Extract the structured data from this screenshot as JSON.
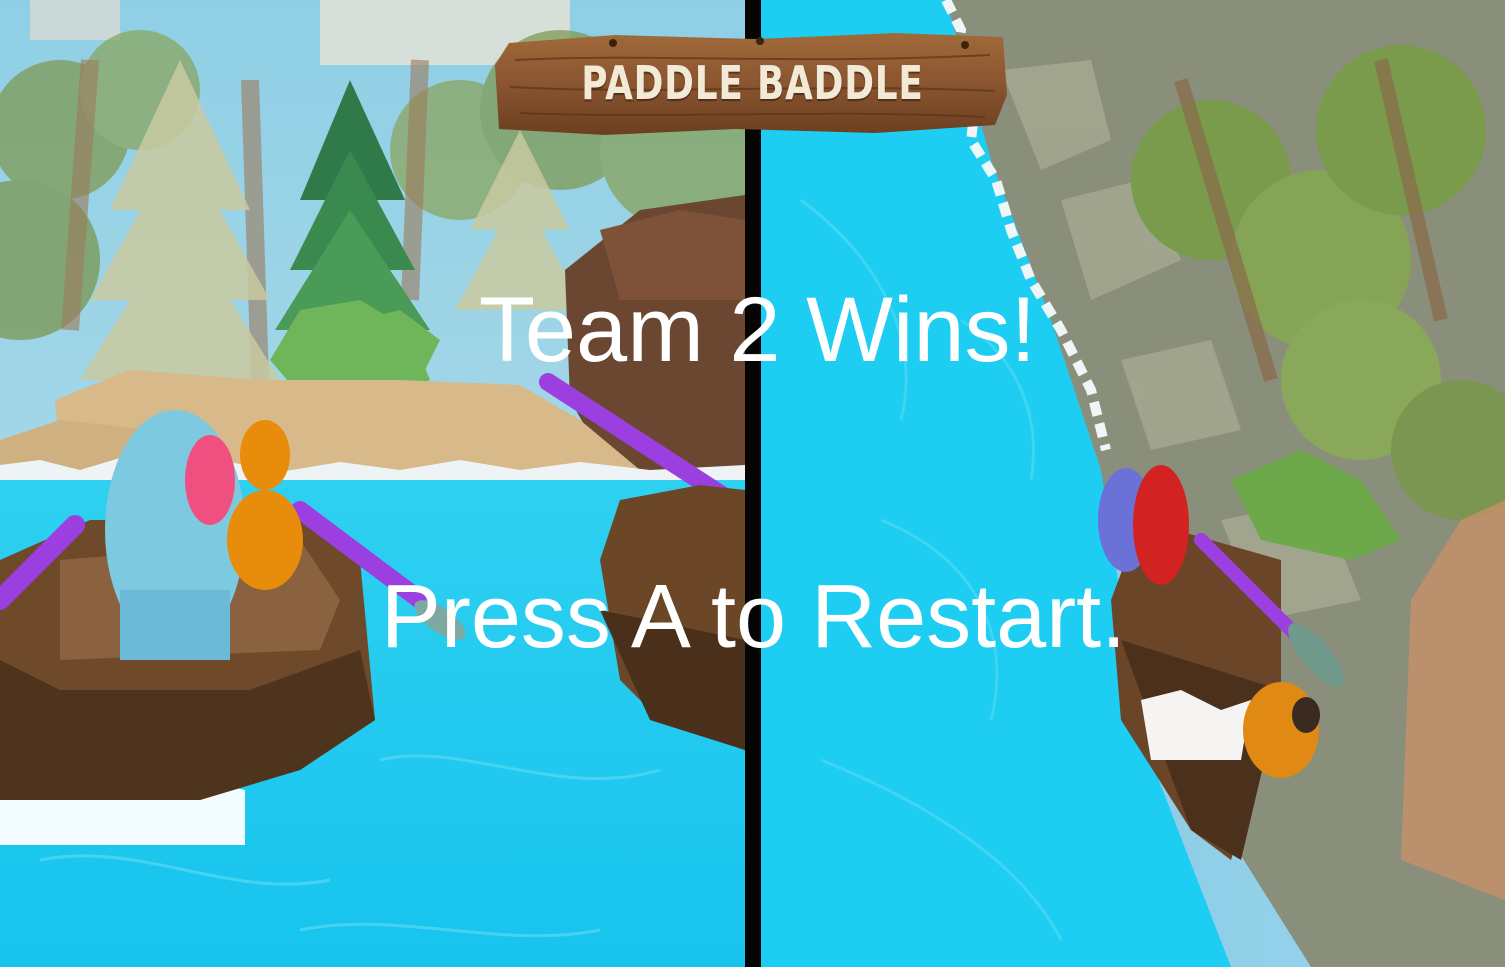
{
  "game": {
    "logo_text": "PADDLE BADDLE",
    "win_message": "Team 2 Wins!",
    "restart_prompt": "Press A to Restart."
  },
  "views": [
    {
      "name": "player-1-view",
      "scene": "boat on lake beside pine trees"
    },
    {
      "name": "player-2-view",
      "scene": "boat on waterfall river beside cliff"
    }
  ],
  "colors": {
    "water": "#1fcdf2",
    "paddle": "#9b3fe0",
    "boat": "#6e4a2a",
    "text": "#ffffff",
    "divider": "#050505",
    "sign": "#8a5530"
  }
}
